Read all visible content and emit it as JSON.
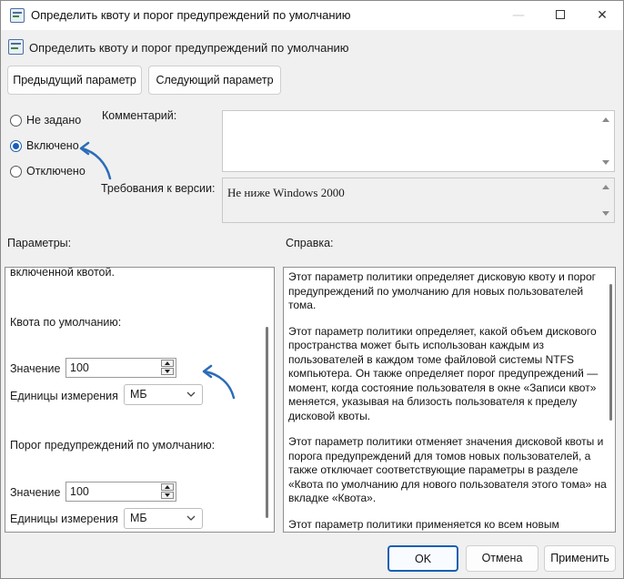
{
  "window": {
    "title": "Определить квоту и порог предупреждений по умолчанию",
    "minimize": "—",
    "close": "✕"
  },
  "header": {
    "title": "Определить квоту и порог предупреждений по умолчанию"
  },
  "nav": {
    "prev_label": "Предыдущий параметр",
    "next_label": "Следующий параметр"
  },
  "state": {
    "options": [
      {
        "label": "Не задано",
        "selected": false
      },
      {
        "label": "Включено",
        "selected": true
      },
      {
        "label": "Отключено",
        "selected": false
      }
    ]
  },
  "comment": {
    "label": "Комментарий:",
    "value": ""
  },
  "supported": {
    "label": "Требования к версии:",
    "value": "Не ниже Windows 2000"
  },
  "options_panel": {
    "label": "Параметры:",
    "partial_text": "включенной квотой.",
    "quota": {
      "heading": "Квота по умолчанию:",
      "value_label": "Значение",
      "value": "100",
      "units_label": "Единицы измерения",
      "units": "МБ"
    },
    "threshold": {
      "heading": "Порог предупреждений по умолчанию:",
      "value_label": "Значение",
      "value": "100",
      "units_label": "Единицы измерения",
      "units": "МБ"
    }
  },
  "help": {
    "label": "Справка:",
    "paragraphs": [
      "Этот параметр политики определяет дисковую квоту и порог предупреждений по умолчанию для новых пользователей тома.",
      "Этот параметр политики определяет, какой объем дискового пространства может быть использован каждым из пользователей в каждом томе файловой системы NTFS компьютера. Он также определяет порог предупреждений — момент, когда состояние пользователя в окне «Записи квот» меняется, указывая на близость пользователя к пределу дисковой квоты.",
      "Этот параметр политики отменяет значения дисковой квоты и порога предупреждений для томов новых пользователей, а также отключает соответствующие параметры в разделе «Квота по умолчанию для нового пользователя этого тома» на вкладке «Квота».",
      "Этот параметр политики применяется ко всем новым"
    ]
  },
  "footer": {
    "ok": "OK",
    "cancel": "Отмена",
    "apply": "Применить"
  },
  "colors": {
    "accent": "#1a5fb4",
    "annotation_arrow": "#2b6cb8"
  }
}
